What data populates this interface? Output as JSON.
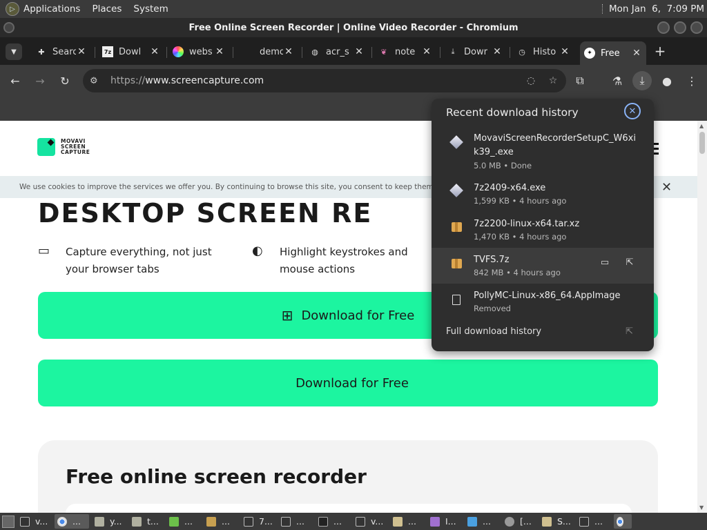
{
  "top_panel": {
    "menus": [
      "Applications",
      "Places",
      "System"
    ],
    "clock": "Mon Jan  6,  7:09 PM"
  },
  "window": {
    "title": "Free Online Screen Recorder | Online Video Recorder - Chromium"
  },
  "tabs": [
    {
      "label": "Searc",
      "icon": "puzzle-icon"
    },
    {
      "label": "Dowl",
      "icon": "archive-7z-icon"
    },
    {
      "label": "webs",
      "icon": "colorwheel-icon"
    },
    {
      "label": "demo",
      "icon": "blank-icon"
    },
    {
      "label": "acr_s",
      "icon": "globe-icon"
    },
    {
      "label": "note",
      "icon": "feather-icon"
    },
    {
      "label": "Dowr",
      "icon": "download-icon"
    },
    {
      "label": "Histo",
      "icon": "history-icon"
    },
    {
      "label": "Free",
      "icon": "movavi-icon",
      "active": true
    }
  ],
  "toolbar": {
    "url_scheme": "https://",
    "url_host": "www.screencapture.com"
  },
  "page": {
    "logo_lines": [
      "MOVAVI",
      "SCREEN",
      "CAPTURE"
    ],
    "cookie_text": "We use cookies to improve the services we offer you. By continuing to browse this site, you consent to keep them in accordance with our Cookie Policy",
    "hero_title": "DESKTOP SCREEN RE",
    "features": [
      {
        "text": "Capture everything, not just your browser tabs",
        "icon": "monitor-icon"
      },
      {
        "text": "Highlight keystrokes and mouse actions",
        "icon": "mouse-icon"
      }
    ],
    "download_windows": "Download for Free",
    "download_mac": "Download for Free",
    "section_title": "Free online screen recorder"
  },
  "download_popup": {
    "title": "Recent download history",
    "items": [
      {
        "name": "MovaviScreenRecorderSetupC_W6xik39_.exe",
        "sub": "5.0 MB • Done",
        "icon": "exe-icon"
      },
      {
        "name": "7z2409-x64.exe",
        "sub": "1,599 KB • 4 hours ago",
        "icon": "exe-icon"
      },
      {
        "name": "7z2200-linux-x64.tar.xz",
        "sub": "1,470 KB • 4 hours ago",
        "icon": "archive-icon"
      },
      {
        "name": "TVFS.7z",
        "sub": "842 MB • 4 hours ago",
        "icon": "archive-icon"
      },
      {
        "name": "PollyMC-Linux-x86_64.AppImage",
        "sub": "Removed",
        "icon": "file-icon"
      }
    ],
    "full_history": "Full download history"
  },
  "taskbar": {
    "items": [
      {
        "label": "v...",
        "icon": "term"
      },
      {
        "label": "...",
        "icon": "chrome",
        "active": true
      },
      {
        "label": "y...",
        "icon": "folder"
      },
      {
        "label": "t...",
        "icon": "folder"
      },
      {
        "label": "...",
        "icon": "green"
      },
      {
        "label": "...",
        "icon": "cube"
      },
      {
        "label": "7...",
        "icon": "term"
      },
      {
        "label": "...",
        "icon": "term"
      },
      {
        "label": "...",
        "icon": "seven"
      },
      {
        "label": "v...",
        "icon": "term"
      },
      {
        "label": "...",
        "icon": "doc"
      },
      {
        "label": "I...",
        "icon": "img"
      },
      {
        "label": "...",
        "icon": "play"
      },
      {
        "label": "[...",
        "icon": "round"
      },
      {
        "label": "S...",
        "icon": "doc"
      },
      {
        "label": "...",
        "icon": "term"
      },
      {
        "label": "",
        "icon": "chrome",
        "active": true
      }
    ]
  },
  "colors": {
    "accent_green": "#1cf5a0",
    "popup_bg": "#2e2e2e",
    "link_blue": "#8ab4f8"
  }
}
